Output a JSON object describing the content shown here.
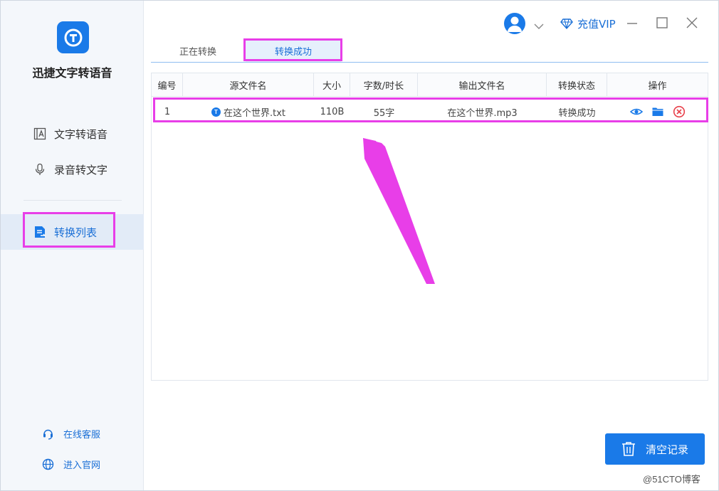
{
  "app": {
    "name": "迅捷文字转语音",
    "logo_glyph": "T"
  },
  "sidebar": {
    "items": [
      {
        "label": "文字转语音",
        "icon": "text-to-speech-icon"
      },
      {
        "label": "录音转文字",
        "icon": "microphone-icon"
      },
      {
        "label": "转换列表",
        "icon": "conversion-list-icon"
      }
    ],
    "footer": [
      {
        "label": "在线客服",
        "icon": "headset-icon"
      },
      {
        "label": "进入官网",
        "icon": "globe-icon"
      }
    ]
  },
  "header": {
    "vip_label": "充值VIP"
  },
  "tabs": [
    {
      "label": "正在转换"
    },
    {
      "label": "转换成功"
    }
  ],
  "table": {
    "columns": [
      "编号",
      "源文件名",
      "大小",
      "字数/时长",
      "输出文件名",
      "转换状态",
      "操作"
    ],
    "rows": [
      {
        "index": "1",
        "source_file": "在这个世界.txt",
        "size": "110B",
        "length": "55字",
        "output_file": "在这个世界.mp3",
        "status": "转换成功"
      }
    ]
  },
  "actions": {
    "clear_label": "清空记录"
  },
  "watermark": "@51CTO博客",
  "colors": {
    "accent": "#1a7ae8",
    "highlight": "#e83ee8",
    "delete": "#e8404a"
  }
}
